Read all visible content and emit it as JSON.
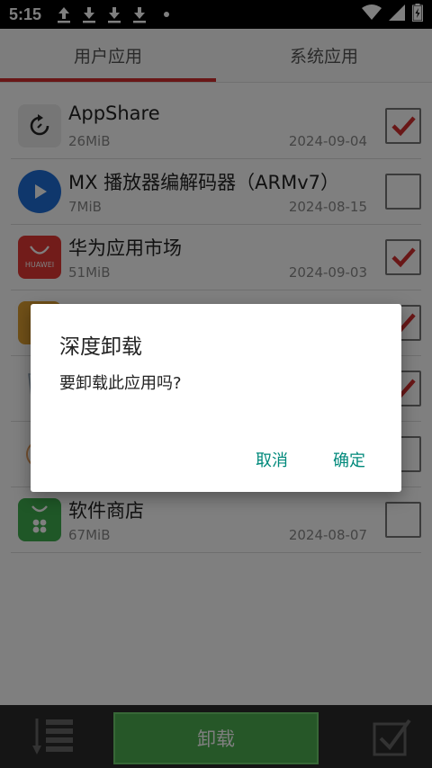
{
  "status_bar": {
    "time": "5:15",
    "icons": [
      "upload-icon",
      "download-icon",
      "download-icon",
      "download-icon",
      "dot-icon",
      "wifi-icon",
      "signal-icon",
      "battery-icon"
    ]
  },
  "tabs": [
    {
      "label": "用户应用",
      "active": true
    },
    {
      "label": "系统应用",
      "active": false
    }
  ],
  "apps": [
    {
      "name": "AppShare",
      "size": "26MiB",
      "date": "2024-09-04",
      "checked": true
    },
    {
      "name": "MX 播放器编解码器（ARMv7）",
      "size": "7MiB",
      "date": "2024-08-15",
      "checked": false
    },
    {
      "name": "华为应用市场",
      "size": "51MiB",
      "date": "2024-09-03",
      "checked": true
    },
    {
      "name": "",
      "size": "",
      "date": "",
      "checked": true
    },
    {
      "name": "",
      "size": "",
      "date": "",
      "checked": true
    },
    {
      "name": "",
      "size": "",
      "date": "",
      "checked": false
    },
    {
      "name": "软件商店",
      "size": "67MiB",
      "date": "2024-08-07",
      "checked": false
    }
  ],
  "huawei_logo_text": "HUAWEI",
  "bottom_bar": {
    "uninstall_label": "卸载"
  },
  "dialog": {
    "title": "深度卸载",
    "message": "要卸载此应用吗?",
    "cancel_label": "取消",
    "ok_label": "确定"
  },
  "colors": {
    "accent_red": "#d32f2f",
    "uninstall_green": "#4caf50",
    "dialog_button": "#00897b"
  }
}
